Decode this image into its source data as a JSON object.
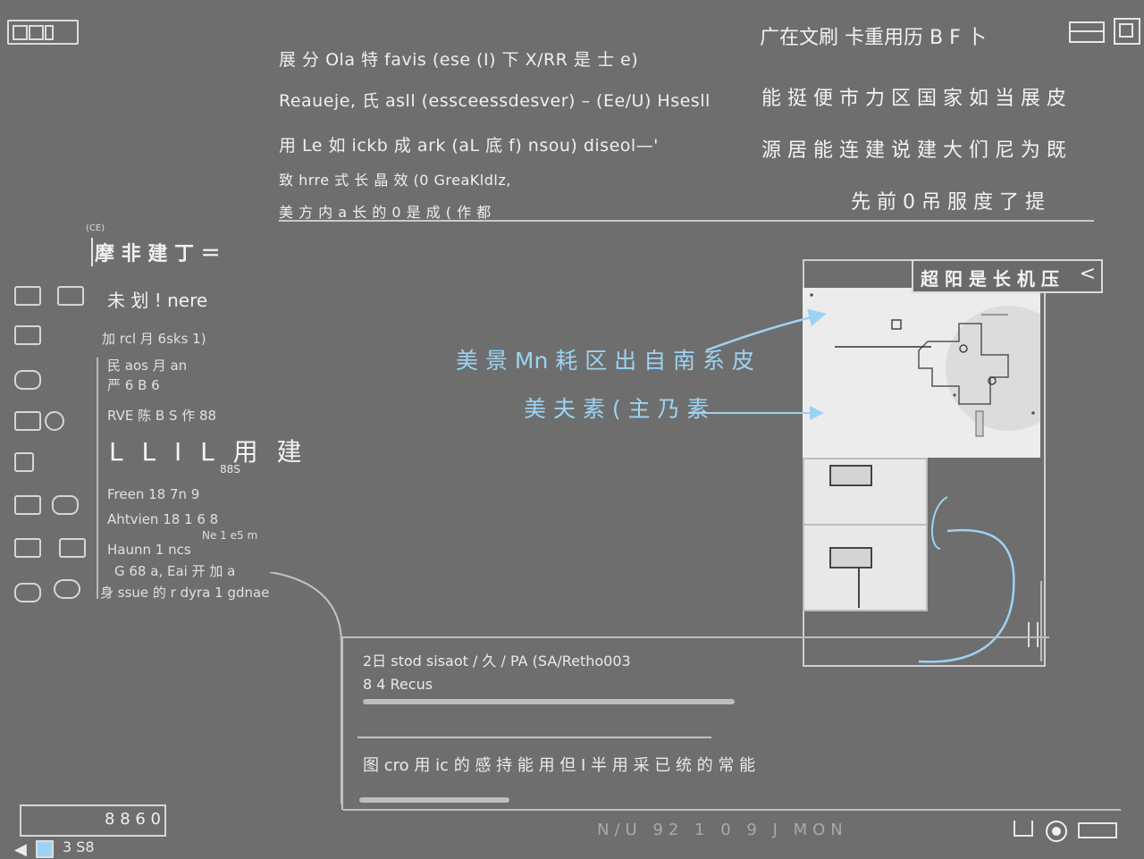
{
  "app": {
    "logo_label": "logo"
  },
  "titlebar": {
    "top_right_text": "广在文刷 卡重用历 B F 卜"
  },
  "header": {
    "line1": "展 分 Ola 特 favis (ese (I) 下 X/RR 是 士 e)",
    "line2": "Reaueje, 氏 asll (essceessdesver) – (Ee/U) Hsesll",
    "line3": "用 Le 如 ickb 成 ark (aL 底 f) nsou) diseol—'",
    "line4": "致 hrre 式 长 晶 效 (0 GreaKldlz,",
    "line5": "美 方 内 a 长 的 0 是 成 ( 作 都",
    "right1": "能 挺 便 市 力 区 国 家 如 当 展 皮",
    "right2": "源 居 能 连 建 说 建 大 们 尼 为 既",
    "right3": "先 前 0 吊 服 度 了 提"
  },
  "sidebar": {
    "section_tag": "(CE)",
    "section_title": "摩 非 建 丁 ＝",
    "items": [
      {
        "label": "未 划 ! nere",
        "icon": "window-icon"
      },
      {
        "label": "加 rcl 月 6sks 1)",
        "icon": "user-icon"
      },
      {
        "label": "民 aos 月 an",
        "icon": "pen-icon"
      },
      {
        "label": "严 6 B 6",
        "icon": "home-icon"
      },
      {
        "label": "RVE 陈 B S 作 88",
        "icon": "bookmark-icon"
      },
      {
        "label": "L L I L 用 建",
        "icon": "grid-icon"
      },
      {
        "label": "Freen 18 7n 9",
        "icon": "folder-icon"
      },
      {
        "label": "Ahtvien 18 1 6 8",
        "icon": "folder-icon"
      },
      {
        "label": "Haunn 1 ncs",
        "icon": "folder-icon"
      },
      {
        "label": "G 68 a, Eai 开 加 a",
        "icon": "cloud-icon"
      },
      {
        "label": "身 ssue 的 r dyra 1 gdnae",
        "icon": "cloud-icon"
      }
    ],
    "small_tag": "88S",
    "small_tag2": "Ne 1 e5 m"
  },
  "panel": {
    "title": "超 阳 是 长 机 压",
    "close": "<"
  },
  "callouts": {
    "c1": "美 景 Mn 耗 区 出 自 南 系 皮",
    "c2": "美 夫 素 ( 主 乃 素"
  },
  "bottom": {
    "line1": "2日 stod sisaot / 久 / PA (SA/Retho003",
    "line2": "8 4 Recus",
    "line3": "图 cro 用 ic 的 感 持 能 用 但 I 半 用 采 已 统 的 常 能"
  },
  "statusbar": {
    "box_label": "8 8 6 0",
    "bottom_left": "3 S8",
    "bottom_right": "N/U 92 1 0 9 J MON"
  }
}
